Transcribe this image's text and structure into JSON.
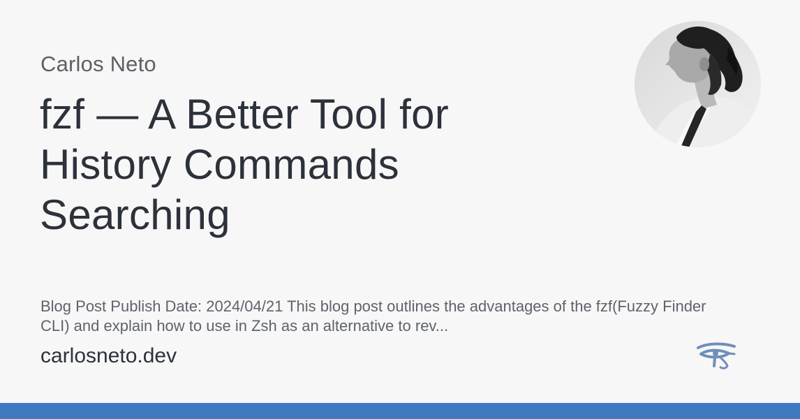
{
  "card": {
    "author": "Carlos Neto",
    "title": "fzf — A Better Tool for History Commands Searching",
    "description": "Blog Post Publish Date: 2024/04/21 This blog post outlines the advantages of the fzf(Fuzzy Finder CLI) and explain how to use in Zsh as an alternative to rev...",
    "domain": "carlosneto.dev",
    "avatar_icon": "author-portrait",
    "logo_icon": "eye-of-horus-icon"
  },
  "colors": {
    "background": "#f7f7f8",
    "title": "#2c313a",
    "muted_text": "#5e636a",
    "accent_bar": "#3f79c0",
    "logo": "#6f8fb8"
  }
}
